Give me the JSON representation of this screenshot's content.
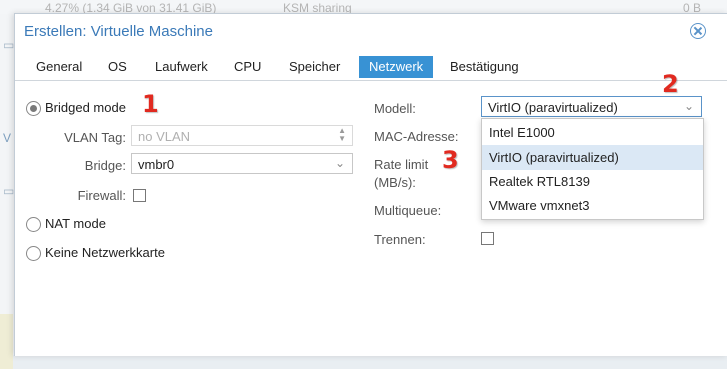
{
  "background": {
    "top_text_usage": "4.27% (1.34 GiB von 31.41 GiB)",
    "top_text_ksm": "KSM sharing",
    "top_text_value": "0 B",
    "left_fragment": "V"
  },
  "dialog": {
    "title": "Erstellen: Virtuelle Maschine",
    "close_icon": "close-circle-icon"
  },
  "tabs": [
    {
      "label": "General"
    },
    {
      "label": "OS"
    },
    {
      "label": "Laufwerk"
    },
    {
      "label": "CPU"
    },
    {
      "label": "Speicher"
    },
    {
      "label": "Netzwerk",
      "active": true
    },
    {
      "label": "Bestätigung"
    }
  ],
  "network": {
    "bridged_label": "Bridged mode",
    "vlan_label": "VLAN Tag:",
    "vlan_placeholder": "no VLAN",
    "bridge_label": "Bridge:",
    "bridge_value": "vmbr0",
    "firewall_label": "Firewall:",
    "nat_label": "NAT mode",
    "none_label": "Keine Netzwerkkarte",
    "model_label": "Modell:",
    "model_value": "VirtIO (paravirtualized)",
    "mac_label": "MAC-Adresse:",
    "rate_label_line1": "Rate limit",
    "rate_label_line2": "(MB/s):",
    "multiqueue_label": "Multiqueue:",
    "disconnect_label": "Trennen:"
  },
  "model_options": [
    {
      "label": "Intel E1000"
    },
    {
      "label": "VirtIO (paravirtualized)",
      "selected": true
    },
    {
      "label": "Realtek RTL8139"
    },
    {
      "label": "VMware vmxnet3"
    }
  ],
  "annotations": {
    "one": "1",
    "two": "2",
    "three": "3"
  },
  "colors": {
    "accent": "#3892d4",
    "title": "#3b7ab8",
    "annotation": "#e12a20",
    "selected_option": "#dbe8f5"
  }
}
